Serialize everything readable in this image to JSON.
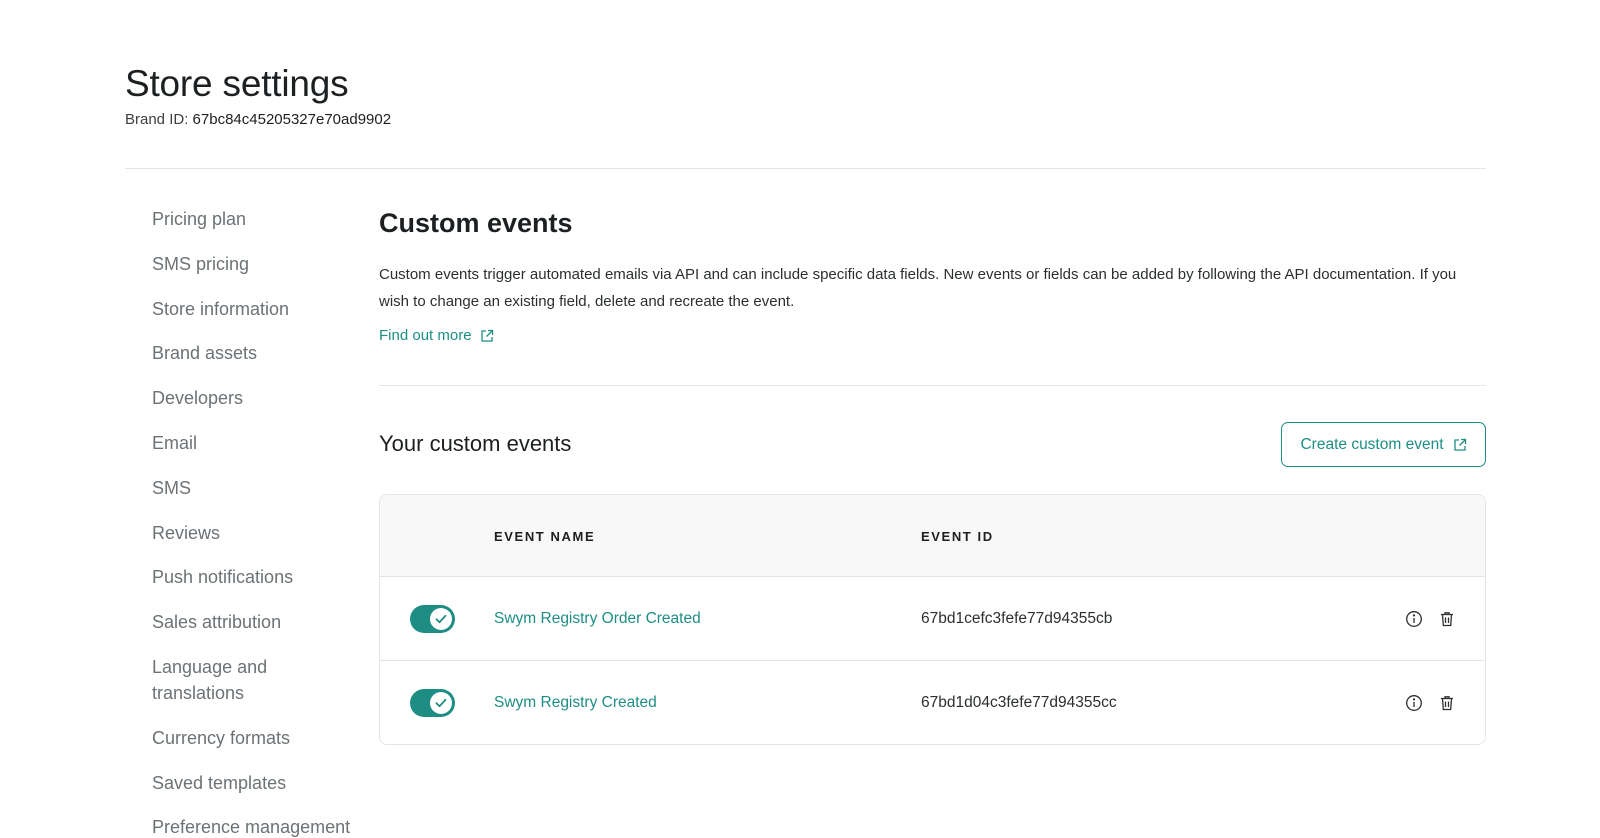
{
  "header": {
    "title": "Store settings",
    "brand_label": "Brand ID:",
    "brand_id": "67bc84c45205327e70ad9902"
  },
  "sidebar": {
    "items": [
      {
        "label": "Pricing plan"
      },
      {
        "label": "SMS pricing"
      },
      {
        "label": "Store information"
      },
      {
        "label": "Brand assets"
      },
      {
        "label": "Developers"
      },
      {
        "label": "Email"
      },
      {
        "label": "SMS"
      },
      {
        "label": "Reviews"
      },
      {
        "label": "Push notifications"
      },
      {
        "label": "Sales attribution"
      },
      {
        "label": "Language and translations"
      },
      {
        "label": "Currency formats"
      },
      {
        "label": "Saved templates"
      },
      {
        "label": "Preference management"
      }
    ]
  },
  "main": {
    "title": "Custom events",
    "description": "Custom events trigger automated emails via API and can include specific data fields. New events or fields can be added by following the API documentation. If you wish to change an existing field, delete and recreate the event.",
    "find_more_label": "Find out more",
    "events_title": "Your custom events",
    "create_button_label": "Create custom event"
  },
  "table": {
    "columns": [
      "EVENT NAME",
      "EVENT ID"
    ],
    "rows": [
      {
        "enabled": true,
        "name": "Swym Registry Order Created",
        "id": "67bd1cefc3fefe77d94355cb"
      },
      {
        "enabled": true,
        "name": "Swym Registry Created",
        "id": "67bd1d04c3fefe77d94355cc"
      }
    ]
  },
  "colors": {
    "accent": "#1e8e84",
    "text": "#1c2022",
    "muted": "#6c7275",
    "divider": "#e3e6e7",
    "table_header_bg": "#f8f8f8"
  },
  "icons": [
    "external-link-icon",
    "check-icon",
    "info-icon",
    "trash-icon"
  ]
}
